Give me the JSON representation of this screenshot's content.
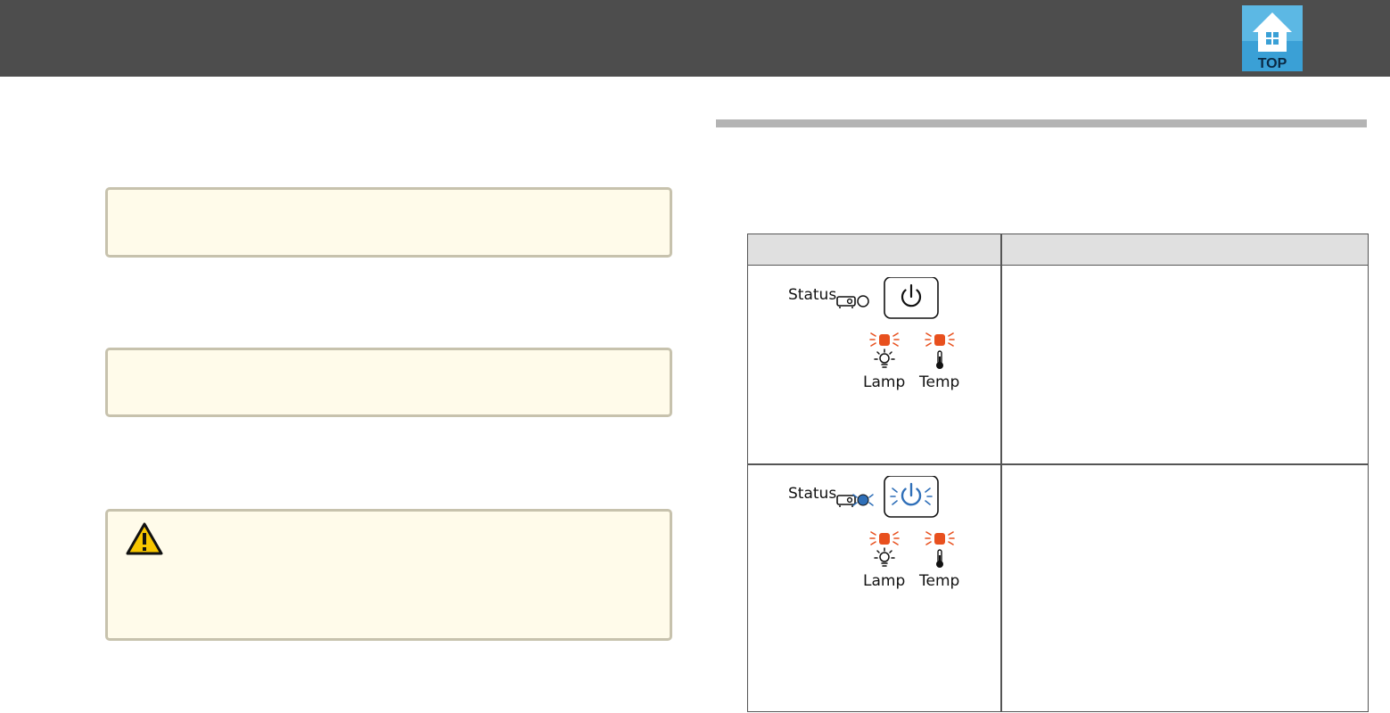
{
  "header": {
    "top_label": "TOP"
  },
  "indicators": {
    "row1": {
      "status_label": "Status",
      "lamp_label": "Lamp",
      "temp_label": "Temp",
      "status_light": "off",
      "power_button": "not lit",
      "lamp_light": "flashing orange",
      "temp_light": "flashing orange"
    },
    "row2": {
      "status_label": "Status",
      "lamp_label": "Lamp",
      "temp_label": "Temp",
      "status_light": "flashing blue",
      "power_button": "flashing blue",
      "lamp_light": "flashing orange",
      "temp_light": "flashing orange"
    }
  },
  "colors": {
    "header_bg": "#4d4d4d",
    "note_bg": "#fffbea",
    "note_border": "#c7c2ad",
    "indicator_orange": "#e8501e",
    "indicator_blue": "#2f6fb8",
    "top_icon_blue": "#3aa0d6"
  },
  "icons": {
    "top": "top-house-icon",
    "warning": "warning-triangle-icon",
    "power": "power-icon",
    "projector": "projector-icon",
    "lamp": "lamp-bulb-icon",
    "temp": "thermometer-icon"
  }
}
